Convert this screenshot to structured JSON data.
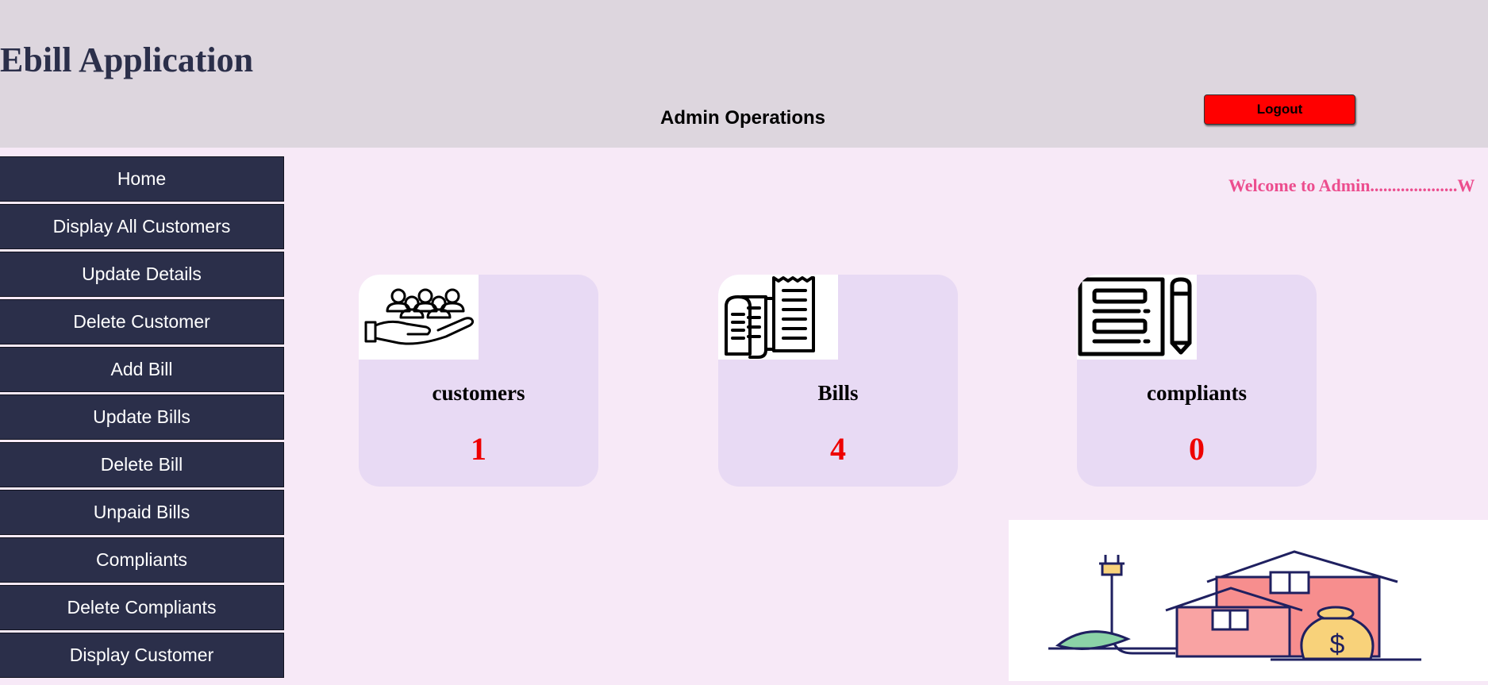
{
  "header": {
    "app_title": "Ebill Application",
    "section_title": "Admin Operations",
    "logout_label": "Logout"
  },
  "sidebar": {
    "items": [
      {
        "label": "Home"
      },
      {
        "label": "Display All Customers"
      },
      {
        "label": "Update Details"
      },
      {
        "label": "Delete Customer"
      },
      {
        "label": "Add Bill"
      },
      {
        "label": "Update Bills"
      },
      {
        "label": "Delete Bill"
      },
      {
        "label": "Unpaid Bills"
      },
      {
        "label": "Compliants"
      },
      {
        "label": "Delete Compliants"
      },
      {
        "label": "Display Customer"
      }
    ]
  },
  "main": {
    "welcome_text": "Welcome to Admin....................W",
    "cards": [
      {
        "label": "customers",
        "count": "1",
        "icon": "customers-hand-icon"
      },
      {
        "label": "Bills",
        "count": "4",
        "icon": "bills-receipt-icon"
      },
      {
        "label": "compliants",
        "count": "0",
        "icon": "complaint-form-pencil-icon"
      }
    ],
    "illustration_icon": "electric-house-money-illustration"
  },
  "colors": {
    "header_bg": "#ddd6de",
    "sidebar_bg": "#2b2f4a",
    "main_bg": "#f7e9f7",
    "card_bg": "#e8daf4",
    "logout_bg": "#ff0000",
    "count_color": "#ee0000",
    "welcome_color": "#ec4d8e"
  }
}
